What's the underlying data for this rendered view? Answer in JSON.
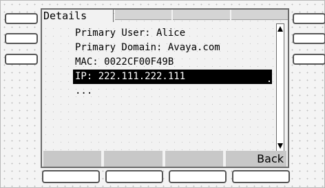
{
  "screen": {
    "title": "Details",
    "lines": [
      "Primary User: Alice",
      "Primary Domain: Avaya.com",
      "MAC: 0022CF00F49B"
    ],
    "selected_line": "IP:  222.111.222.111",
    "more_indicator": "..."
  },
  "softkeys": {
    "labels": [
      "",
      "",
      "",
      "Back"
    ]
  },
  "icons": {
    "scroll_up": "scroll-up-arrow-icon",
    "scroll_down": "scroll-down-arrow-icon"
  }
}
